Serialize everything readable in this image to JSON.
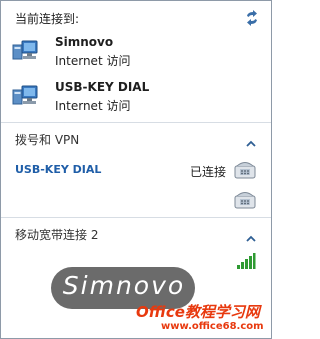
{
  "header": {
    "title": "当前连接到:",
    "refresh_icon": "refresh-icon"
  },
  "connections": [
    {
      "name": "Simnovo",
      "status": "Internet 访问",
      "icon": "network-computer-icon"
    },
    {
      "name": "USB-KEY DIAL",
      "status": "Internet 访问",
      "icon": "network-computer-icon"
    }
  ],
  "vpn_section": {
    "label": "拨号和 VPN",
    "items": [
      {
        "name": "USB-KEY DIAL",
        "status": "已连接",
        "icon": "modem-phone-icon"
      },
      {
        "name": "",
        "status": "",
        "icon": "modem-phone-icon"
      }
    ]
  },
  "mobile_section": {
    "label": "移动宽带连接 2",
    "icon": "signal-strength-icon"
  },
  "watermark": {
    "text": "Simnovo",
    "site_name": "Office教程学习网",
    "site_url": "www.office68.com"
  },
  "colors": {
    "link_blue": "#1f5ea8",
    "watermark_red": "#e8390e"
  }
}
